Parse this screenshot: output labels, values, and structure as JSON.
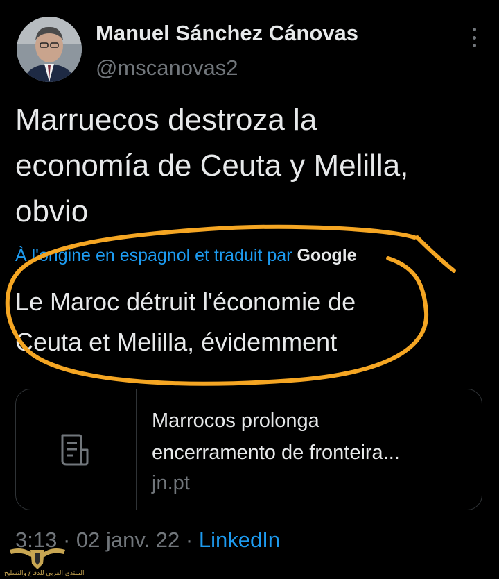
{
  "author": {
    "name": "Manuel Sánchez Cánovas",
    "handle": "@mscanovas2"
  },
  "tweet": {
    "text_line1": "Marruecos destroza la",
    "text_line2": "economía de Ceuta y Melilla,",
    "text_line3": "obvio",
    "translated_by_label": "À l'origine en espagnol et traduit par",
    "translator": "Google",
    "translation_line1": "Le Maroc détruit l'économie de",
    "translation_line2": "Ceuta et Melilla, évidemment"
  },
  "link_card": {
    "title_line1": "Marrocos prolonga",
    "title_line2": "encerramento de fronteira...",
    "domain": "jn.pt",
    "icon": "document-icon"
  },
  "meta": {
    "time": "3:13",
    "separator1": " · ",
    "date": "02 janv. 22",
    "separator2": " · ",
    "source": "LinkedIn"
  },
  "watermark": {
    "text": "المنتدى العربي للدفاع والتسليح"
  },
  "colors": {
    "background": "#000000",
    "text": "#e7e9ea",
    "muted": "#71767b",
    "accent": "#1d9bf0",
    "annotation": "#f5a623",
    "border": "#2f3336"
  }
}
